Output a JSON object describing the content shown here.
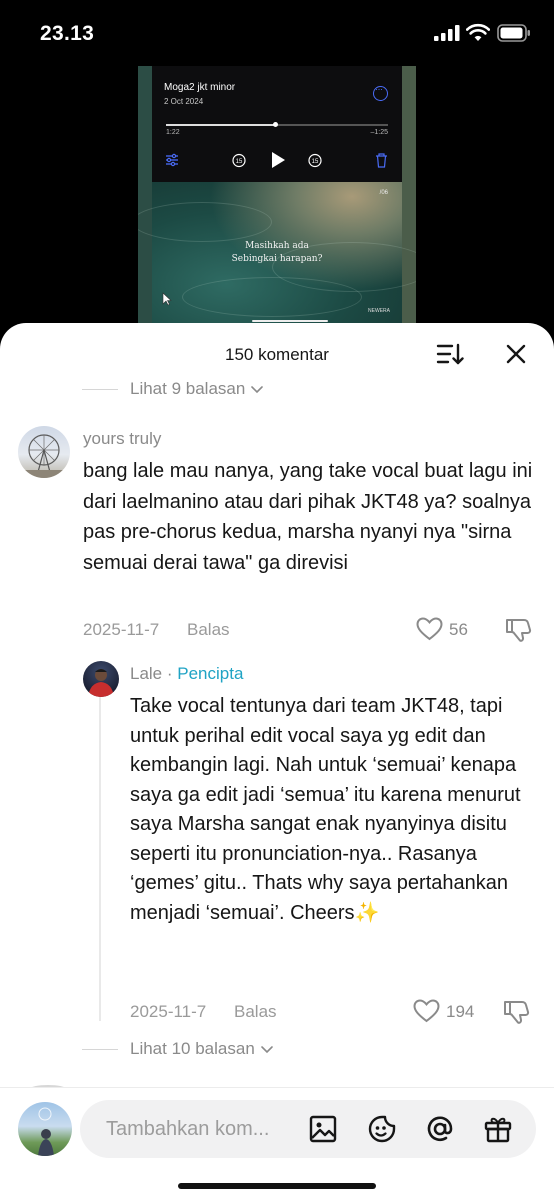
{
  "status_bar": {
    "time": "23.13"
  },
  "video": {
    "player": {
      "title": "Moga2 jkt minor",
      "date": "2 Oct 2024",
      "elapsed": "1:22",
      "remaining": "–1:25",
      "progress": 0.49,
      "skip_back_label": "15",
      "skip_fwd_label": "15"
    },
    "track_counter": "/06",
    "lyric_line1": "Masihkah ada",
    "lyric_line2": "Sebingkai harapan?",
    "watermark": "NEWERA"
  },
  "sheet": {
    "title": "150 komentar"
  },
  "replies_toggle_top": "Lihat 9 balasan",
  "comment": {
    "username": "yours truly",
    "text": "bang lale mau nanya, yang take vocal buat lagu ini dari laelmanino atau dari pihak JKT48 ya? soalnya pas pre-chorus kedua, marsha nyanyi nya \"sirna semuai derai tawa\" ga direvisi",
    "date": "2025-11-7",
    "reply_label": "Balas",
    "likes": "56"
  },
  "reply": {
    "username": "Lale",
    "separator": " · ",
    "badge": "Pencipta",
    "text": "Take vocal tentunya dari team JKT48, tapi untuk perihal edit vocal saya yg edit dan kembangin lagi. Nah untuk ‘semuai’ kenapa saya ga edit jadi ‘semua’ itu karena menurut saya Marsha sangat enak nyanyinya disitu seperti itu pronunciation-nya.. Rasanya ‘gemes’ gitu.. Thats why saya pertahankan menjadi ‘semuai’. Cheers✨",
    "date": "2025-11-7",
    "reply_label": "Balas",
    "likes": "194"
  },
  "replies_toggle_bottom": "Lihat 10 balasan",
  "input": {
    "placeholder": "Tambahkan kom..."
  },
  "colors": {
    "creator_badge": "#1fa3c4",
    "player_accent": "#4a6cf7"
  },
  "icons": [
    "signal-icon",
    "wifi-icon",
    "battery-icon",
    "sort-icon",
    "close-icon",
    "heart-icon",
    "dislike-icon",
    "image-icon",
    "emoji-icon",
    "mention-icon",
    "gift-icon"
  ]
}
